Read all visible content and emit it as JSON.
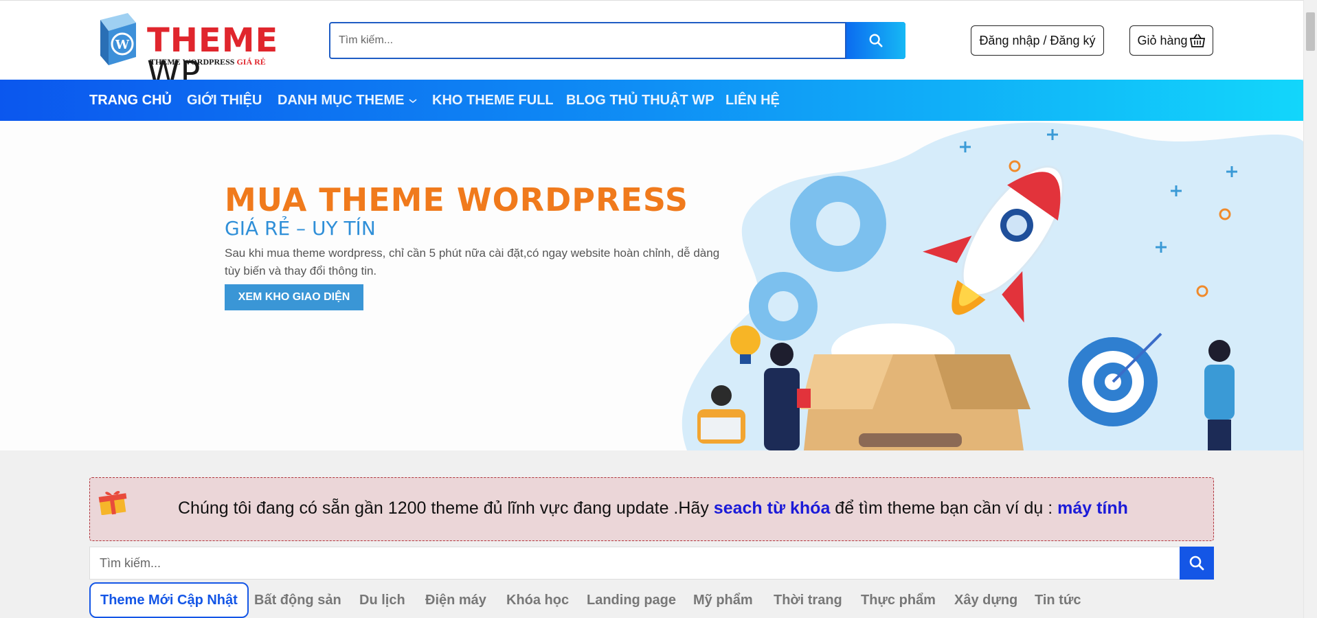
{
  "header": {
    "logo": {
      "text_main": "THEME ",
      "text_wp": "WP",
      "sub_text": "THEME WORDPRESS ",
      "sub_red": "GIÁ RẺ"
    },
    "search": {
      "placeholder": "Tìm kiếm..."
    },
    "login_label": "Đăng nhập / Đăng ký",
    "cart_label": "Giỏ hàng"
  },
  "nav": {
    "items": [
      {
        "label": "TRANG CHỦ"
      },
      {
        "label": "GIỚI THIỆU"
      },
      {
        "label": "DANH MỤC THEME"
      },
      {
        "label": "KHO THEME FULL"
      },
      {
        "label": "BLOG THỦ THUẬT WP"
      },
      {
        "label": "LIÊN HỆ"
      }
    ]
  },
  "hero": {
    "title": "MUA THEME WORDPRESS",
    "subtitle": "GIÁ RẺ – UY TÍN",
    "desc_line1": "Sau khi mua theme wordpress, chỉ cần 5 phút nữa cài đặt,có ngay website hoàn chỉnh, dễ dàng",
    "desc_line2": "tùy biến và thay đổi thông tin.",
    "button": "XEM KHO GIAO DIỆN"
  },
  "notice": {
    "text_before": "Chúng tôi đang có sẵn gần 1200 theme đủ lĩnh vực đang update .Hãy ",
    "highlight1": "seach từ khóa",
    "text_middle": " để tìm theme bạn cần ví dụ : ",
    "highlight2": "máy tính"
  },
  "search2": {
    "placeholder": "Tìm kiếm..."
  },
  "tabs": [
    {
      "label": "Theme Mới Cập Nhật"
    },
    {
      "label": "Bất động sản"
    },
    {
      "label": "Du lịch"
    },
    {
      "label": "Điện máy"
    },
    {
      "label": "Khóa học"
    },
    {
      "label": "Landing page"
    },
    {
      "label": "Mỹ phẩm"
    },
    {
      "label": "Thời trang"
    },
    {
      "label": "Thực phẩm"
    },
    {
      "label": "Xây dựng"
    },
    {
      "label": "Tin tức"
    }
  ],
  "colors": {
    "nav_gradient_start": "#0b57ee",
    "nav_gradient_end": "#12d6fb",
    "hero_title": "#f07a1c",
    "hero_subtitle": "#2f8fd8",
    "notice_bg": "#ebd6d8",
    "accent_blue": "#1456e6"
  }
}
